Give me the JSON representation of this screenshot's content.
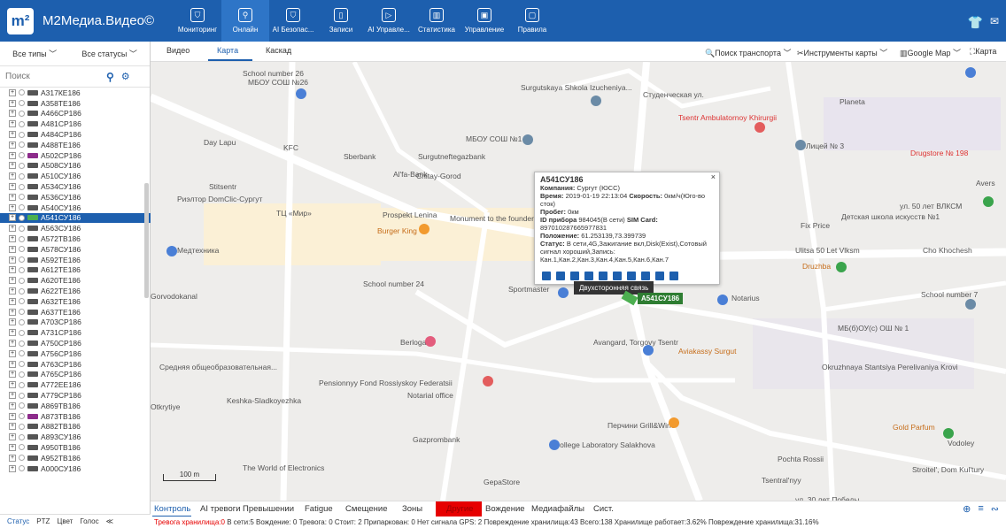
{
  "app": {
    "title": "M2Медиа.Видео©",
    "logo_mark": "m²"
  },
  "toolbar": [
    {
      "label": "Мониторинг",
      "icon": "monitor-icon"
    },
    {
      "label": "Онлайн",
      "icon": "location-icon",
      "active": true
    },
    {
      "label": "AI Безопас...",
      "icon": "shield-icon"
    },
    {
      "label": "Записи",
      "icon": "record-icon"
    },
    {
      "label": "AI Управле...",
      "icon": "play-icon"
    },
    {
      "label": "Статистика",
      "icon": "chart-icon"
    },
    {
      "label": "Управление",
      "icon": "manage-icon"
    },
    {
      "label": "Правила",
      "icon": "rules-icon"
    }
  ],
  "left": {
    "filter_types": "Все типы ﹀",
    "filter_status": "Все статусы ﹀",
    "search_placeholder": "Поиск",
    "vehicles": [
      "А317КЕ186",
      "А358ТЕ186",
      "А466СР186",
      "А481СР186",
      "А484СР186",
      "А488ТЕ186",
      "А502СР186",
      "А508СУ186",
      "А510СУ186",
      "А534СУ186",
      "А536СУ186",
      "А540СУ186",
      "А541СУ186",
      "А563СУ186",
      "А572ТВ186",
      "А578СУ186",
      "А592ТЕ186",
      "А612ТЕ186",
      "А620ТЕ186",
      "А622ТЕ186",
      "А632ТЕ186",
      "А637ТЕ186",
      "А703СР186",
      "А731СР186",
      "А750СР186",
      "А756СР186",
      "А763СР186",
      "А765СР186",
      "А772ЕЕ186",
      "А779СР186",
      "А869ТВ186",
      "А873ТВ186",
      "А882ТВ186",
      "А893СУ186",
      "А950ТВ186",
      "А952ТВ186",
      "А000СУ186"
    ],
    "bottom": [
      "Статус",
      "PTZ",
      "Цвет",
      "Голос",
      "≪"
    ]
  },
  "tabs": [
    "Видео",
    "Карта",
    "Каскад"
  ],
  "map_tools": [
    "🔍Поиск транспорта ﹀",
    "✂Инструменты карты ﹀",
    "▥Google Map ﹀",
    "⛶Карта"
  ],
  "popup": {
    "title": "А541СУ186",
    "company_label": "Компания:",
    "company": "Сургут (ЮСС)",
    "time_label": "Время:",
    "time": "2019-01-19 22:13:04",
    "speed_label": "Скорость:",
    "speed": "0км/ч(Юго-во сток)",
    "mileage_label": "Пробег:",
    "mileage": "0км",
    "device_label": "ID прибора",
    "device": "984045(В сети)",
    "sim_label": "SIM Card:",
    "sim": "897010287665977831",
    "position_label": "Положение:",
    "position": "61.253139,73.399739",
    "status_label": "Статус:",
    "status": "В сети,4G,Зажигание вкл,Disk(Exist),Сотовый сигнал хороший,Запись: Кан.1,Кан.2,Кан.3,Кан.4,Кан.5,Кан.6,Кан.7",
    "tooltip": "Двухсторонняя связь",
    "car_label": "А541СУ186"
  },
  "map_labels": [
    "School number 26",
    "МБОУ СОШ №26",
    "Surgutskaya Shkola Izucheniya...",
    "МБОУ СОШ №1",
    "Студенческая ул.",
    "Tsentr Ambulatornoy Khirurgii",
    "Лицей № 3",
    "Planeta",
    "Drugstore № 198",
    "Avers",
    "Day Lapu",
    "KFC",
    "Sberbank",
    "Surgutneftegazbank",
    "Al'fa-Bank",
    "Chitay-Gorod",
    "Stitsentr",
    "Риэлтор DomClic-Сургут",
    "ТЦ «Мир»",
    "Prospekt Lenina",
    "Burger King",
    "Monument to the founders of Surgut",
    "Медтехника",
    "Fix Price",
    "Детская школа искусств №1",
    "ул. 50 лет ВЛКСМ",
    "Ulitsa 50 Let Vlksm",
    "Druzhba",
    "Cho Khochesh",
    "School number 24",
    "Sportmaster",
    "Notarius",
    "School number 7",
    "MБ(б)ОУ(с) ОШ № 1",
    "Gorvodokanal",
    "Berloga",
    "Avangard, Torgovy Tsentr",
    "Aviakassy Surgut",
    "Okruzhnaya Stantsiya Perelivaniya Krovi",
    "Средняя общеобразовательная...",
    "Pensionnyy Fond Rossiyskoy Federatsii",
    "Keshka-Sladkoyezhka",
    "Otkrytiye",
    "Notarial office",
    "Перчини Grill&Wine",
    "Gold Parfum",
    "Vodoley",
    "Gazprombank",
    "College Laboratory Salakhova",
    "The World of Electronics",
    "GepaStore",
    "Pochta Rossii",
    "Stroitel', Dom Kul'tury",
    "Tsentral'nyy",
    "ул. 30 лет Победы",
    "100 m"
  ],
  "bottom_tabs": [
    "Контроль",
    "AI тревоги",
    "Превышении",
    "Fatigue",
    "Смещение",
    "Зоны",
    "Другие",
    "Вождение",
    "Медиафайлы",
    "Сист."
  ],
  "status_bar": {
    "alarm": "Тревога хранилища:0",
    "rest": "В сети:5  Вождение: 0  Тревога: 0  Стоит: 2  Припаркован: 0  Нет сигнала GPS: 2  Повреждение хранилища:43  Всего:138  Хранилище работает:3.62%  Повреждение хранилища:31.16%"
  }
}
